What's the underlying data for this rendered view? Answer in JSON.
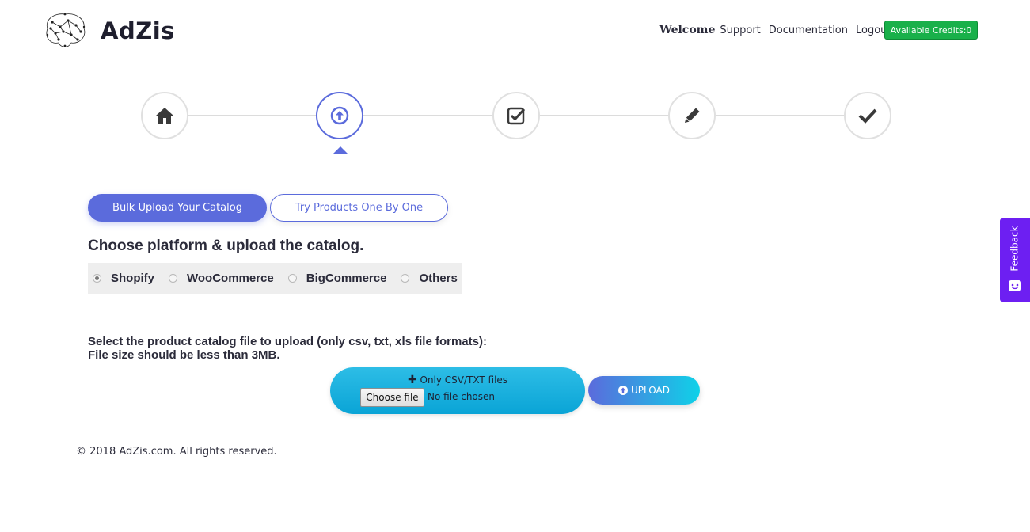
{
  "brand": {
    "name": "AdZis"
  },
  "topnav": {
    "welcome": "Welcome",
    "support": "Support",
    "documentation": "Documentation",
    "logout": "Logout",
    "credits": "Available Credits:0"
  },
  "steps": [
    {
      "icon": "home-icon",
      "active": false
    },
    {
      "icon": "upload-icon",
      "active": true
    },
    {
      "icon": "check-square-icon",
      "active": false
    },
    {
      "icon": "pencil-icon",
      "active": false
    },
    {
      "icon": "checkmark-icon",
      "active": false
    }
  ],
  "tabs": {
    "bulk": "Bulk Upload Your Catalog",
    "single": "Try Products One By One"
  },
  "heading": "Choose platform & upload the catalog.",
  "platforms": {
    "selected": "Shopify",
    "options": [
      "Shopify",
      "WooCommerce",
      "BigCommerce",
      "Others"
    ]
  },
  "instructions": {
    "line1": "Select the product catalog file to upload (only csv, txt, xls file formats):",
    "line2": "File size should be less than 3MB."
  },
  "upload": {
    "file_hint": "Only CSV/TXT files",
    "choose_label": "Choose file",
    "no_file": "No file chosen",
    "button": "UPLOAD"
  },
  "footer": "© 2018 AdZis.com. All rights reserved.",
  "feedback": "Feedback",
  "colors": {
    "primary": "#5b6bdc",
    "credits_green": "#19b04a",
    "upload_cyan": "#0aa4d6",
    "feedback_purple": "#6d1ff2"
  }
}
